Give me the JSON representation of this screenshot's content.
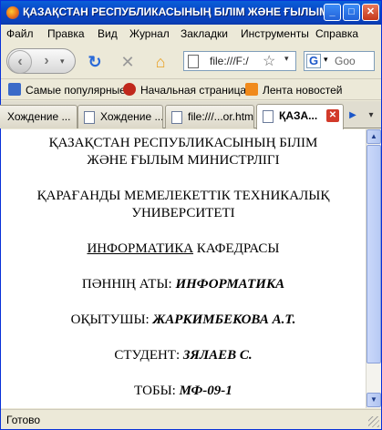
{
  "window": {
    "title": "ҚАЗАҚСТАН РЕСПУБЛИКАСЫНЫҢ БІЛІМ ЖӘНЕ ҒЫЛЫМ М...",
    "minimize": "_",
    "maximize": "□",
    "close": "✕"
  },
  "menu": [
    "Файл",
    "Правка",
    "Вид",
    "Журнал",
    "Закладки",
    "Инструменты",
    "Справка"
  ],
  "nav": {
    "back_icon": "back-arrow-icon",
    "forward_icon": "forward-arrow-icon",
    "url": "file:///F:/",
    "search_placeholder": "Goo"
  },
  "bookmarks": [
    {
      "label": "Самые популярные",
      "icon": "bookmarks-icon"
    },
    {
      "label": "Начальная страница",
      "icon": "firefox-icon"
    },
    {
      "label": "Лента новостей",
      "icon": "rss-icon"
    }
  ],
  "tabs": [
    {
      "label": "Хождение ...",
      "active": false
    },
    {
      "label": "Хождение ...",
      "active": false
    },
    {
      "label": "file:///...or.htm",
      "active": false
    },
    {
      "label": "ҚАЗА...",
      "active": true
    }
  ],
  "document": {
    "ministry_line1": "ҚАЗАҚСТАН РЕСПУБЛИКАСЫНЫҢ БІЛІМ",
    "ministry_line2": "ЖӘНЕ ҒЫЛЫМ МИНИСТРЛІГІ",
    "university_line1": "ҚАРАҒАНДЫ МЕМЕЛЕКЕТТІК ТЕХНИКАЛЫҚ",
    "university_line2": "УНИВЕРСИТЕТІ",
    "department_name": "ИНФОРМАТИКА",
    "department_suffix": " КАФЕДРАСЫ",
    "subject_label": "ПӘННІҢ АТЫ: ",
    "subject_value": "ИНФОРМАТИКА",
    "teacher_label": "ОҚЫТУШЫ: ",
    "teacher_value": "ЖАРКИМБЕКОВА А.Т.",
    "student_label": "СТУДЕНТ: ",
    "student_value": "ЗЯЛАЕВ С.",
    "group_label": "ТОБЫ: ",
    "group_value": "МФ-09-1"
  },
  "status": "Готово"
}
